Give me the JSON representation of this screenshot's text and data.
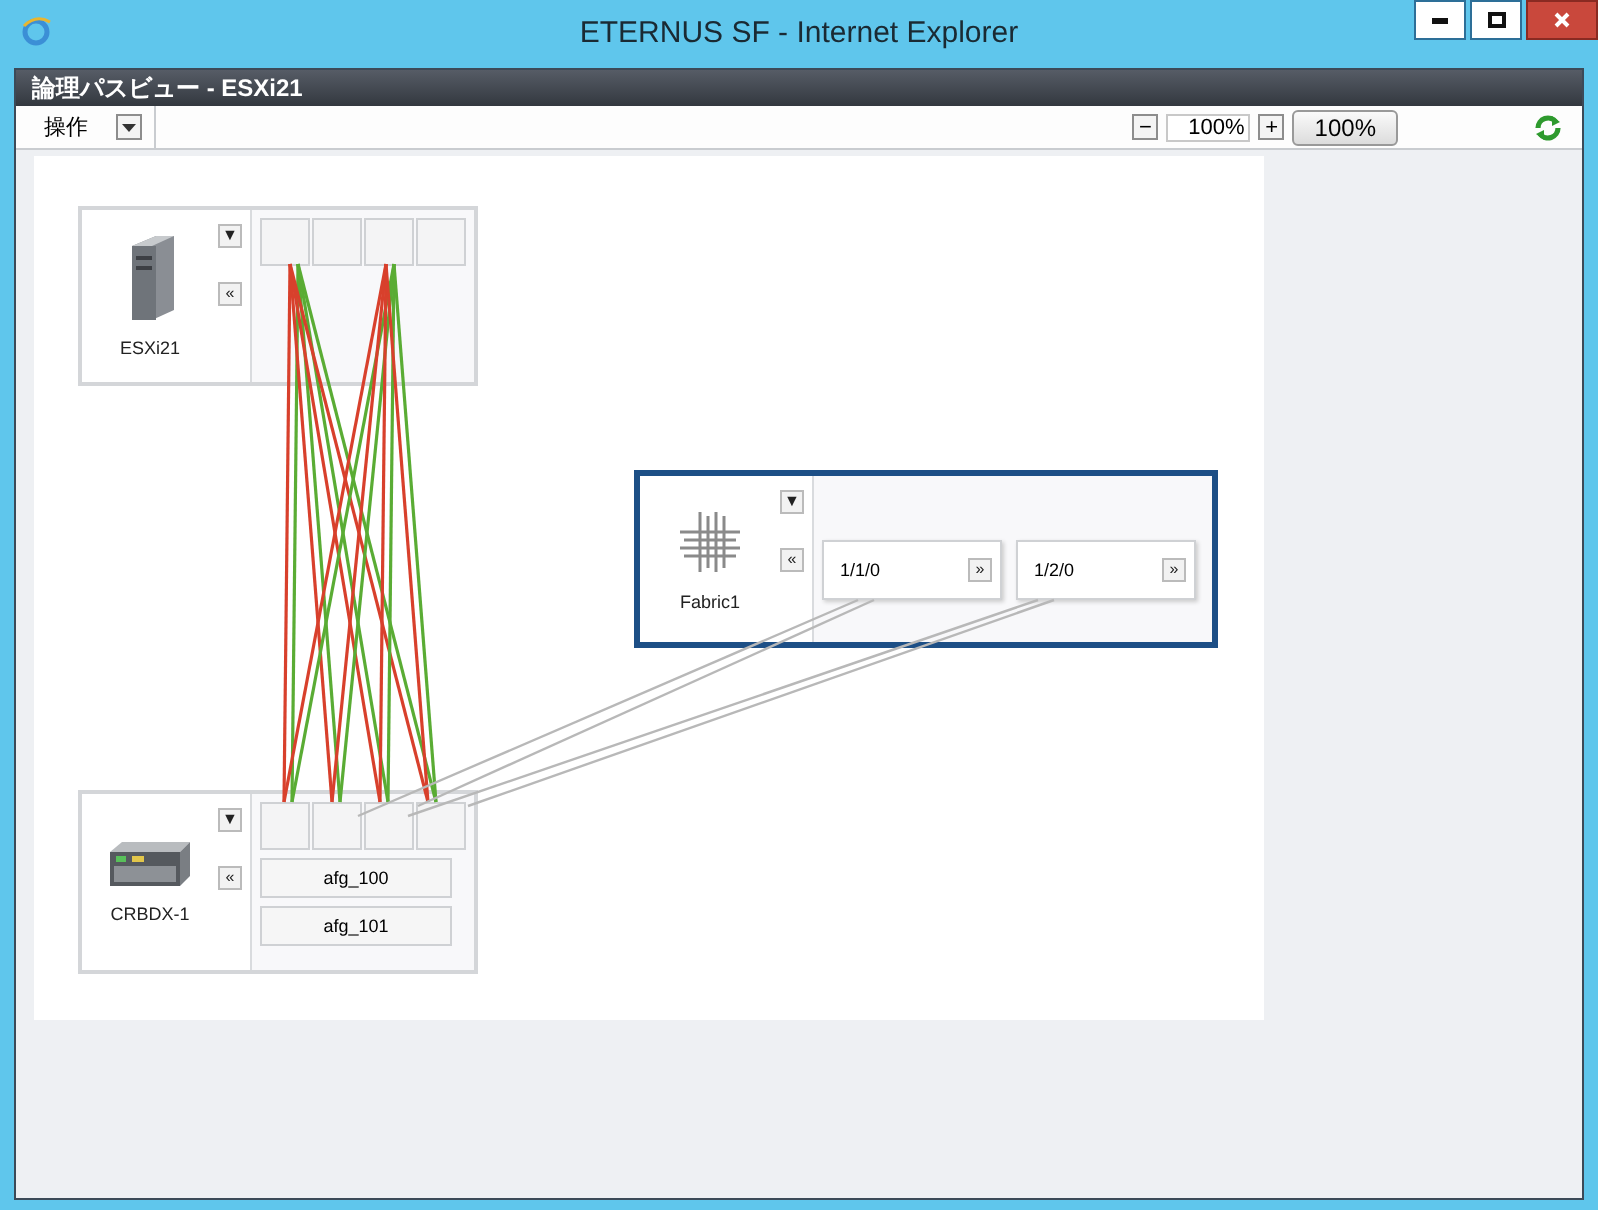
{
  "window": {
    "title": "ETERNUS SF - Internet Explorer"
  },
  "header": {
    "title": "論理パスビュー - ESXi21"
  },
  "toolbar": {
    "menu": "操作",
    "zoom_out": "−",
    "zoom_value": "100%",
    "zoom_in": "+",
    "zoom_reset": "100%"
  },
  "nodes": [
    {
      "kind": "server",
      "label": "ESXi21",
      "selected": false,
      "menu_button": "▼",
      "collapse_button": "«"
    },
    {
      "kind": "switch",
      "label": "Fabric1",
      "selected": true,
      "menu_button": "▼",
      "collapse_button": "«",
      "ports": [
        {
          "label": "1/1/0",
          "expand_button": "»"
        },
        {
          "label": "1/2/0",
          "expand_button": "»"
        }
      ]
    },
    {
      "kind": "storage",
      "label": "CRBDX-1",
      "selected": false,
      "menu_button": "▼",
      "collapse_button": "«",
      "groups": [
        "afg_100",
        "afg_101"
      ]
    }
  ]
}
